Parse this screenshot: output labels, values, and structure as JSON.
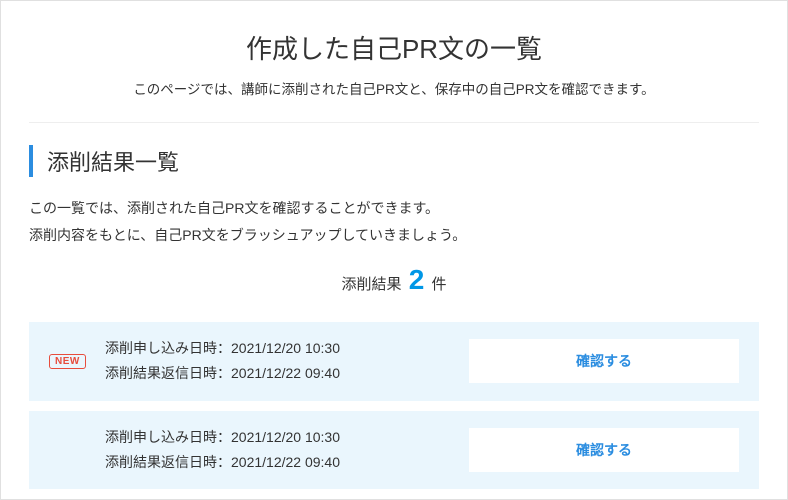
{
  "header": {
    "title": "作成した自己PR文の一覧",
    "subtitle": "このページでは、講師に添削された自己PR文と、保存中の自己PR文を確認できます。"
  },
  "section": {
    "title": "添削結果一覧",
    "desc_line1": "この一覧では、添削された自己PR文を確認することができます。",
    "desc_line2": "添削内容をもとに、自己PR文をブラッシュアップしていきましょう。",
    "count_prefix": "添削結果",
    "count": "2",
    "count_suffix": "件"
  },
  "labels": {
    "apply_label": "添削申し込み日時：",
    "reply_label": "添削結果返信日時：",
    "confirm": "確認する",
    "new_badge": "NEW"
  },
  "items": [
    {
      "is_new": true,
      "apply_dt": "2021/12/20 10:30",
      "reply_dt": "2021/12/22 09:40"
    },
    {
      "is_new": false,
      "apply_dt": "2021/12/20 10:30",
      "reply_dt": "2021/12/22 09:40"
    }
  ],
  "colors": {
    "accent": "#2b8de0",
    "count": "#0097e6",
    "badge": "#e74c3c",
    "item_bg": "#eaf6fd"
  }
}
